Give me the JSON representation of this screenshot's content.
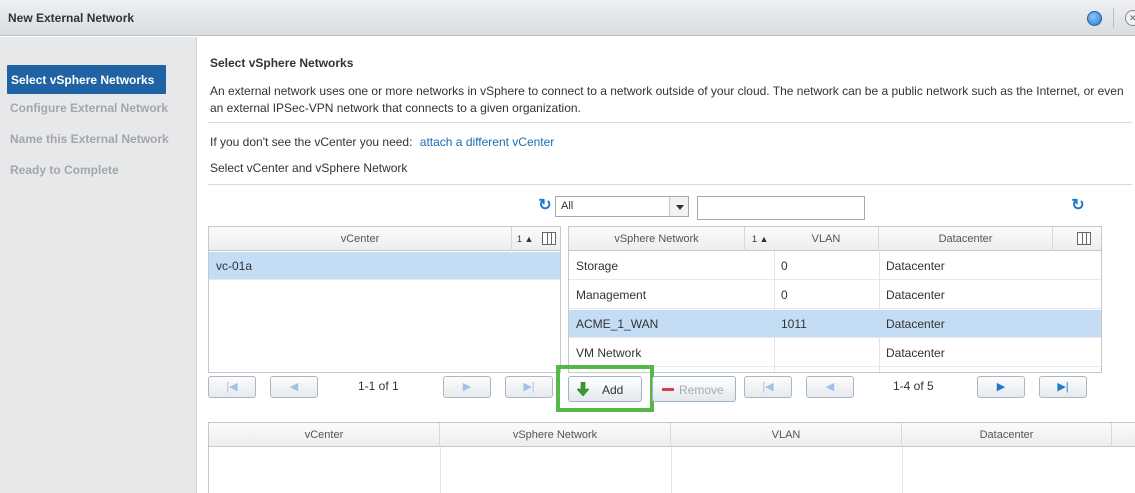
{
  "window": {
    "title": "New External Network"
  },
  "sidebar": {
    "steps": [
      {
        "label": "Select vSphere Networks",
        "active": true
      },
      {
        "label": "Configure External Network",
        "active": false
      },
      {
        "label": "Name this External Network",
        "active": false
      },
      {
        "label": "Ready to Complete",
        "active": false
      }
    ]
  },
  "main": {
    "title": "Select vSphere Networks",
    "description": "An external network uses one or more networks in vSphere to connect to a network outside of your cloud. The network can be a public network such as the Internet, or even an external IPSec-VPN network that connects to a given organization.",
    "vcenter_prompt": "If you don't see the vCenter you need:",
    "vcenter_link": "attach a different vCenter",
    "select_label": "Select vCenter and vSphere Network"
  },
  "vcenter_grid": {
    "columns": [
      "vCenter"
    ],
    "sort_indicator": "1 ▲",
    "rows": [
      {
        "vcenter": "vc-01a",
        "selected": true
      }
    ],
    "pager": {
      "text": "1-1 of 1"
    }
  },
  "network_grid": {
    "filter": {
      "selected": "All",
      "search_value": ""
    },
    "columns": [
      "vSphere Network",
      "VLAN",
      "Datacenter"
    ],
    "sort_indicator": "1 ▲",
    "rows": [
      {
        "network": "Storage",
        "vlan": "0",
        "datacenter": "Datacenter",
        "selected": false
      },
      {
        "network": "Management",
        "vlan": "0",
        "datacenter": "Datacenter",
        "selected": false
      },
      {
        "network": "ACME_1_WAN",
        "vlan": "1011",
        "datacenter": "Datacenter",
        "selected": true
      },
      {
        "network": "VM Network",
        "vlan": "",
        "datacenter": "Datacenter",
        "selected": false
      }
    ],
    "pager": {
      "text": "1-4 of 5"
    }
  },
  "actions": {
    "add_label": "Add",
    "remove_label": "Remove"
  },
  "selected_grid": {
    "columns": [
      "vCenter",
      "vSphere Network",
      "VLAN",
      "Datacenter"
    ]
  },
  "colors": {
    "accent": "#1f63a5",
    "selection": "#c4dcf4",
    "highlight": "#57b84a",
    "link": "#1a6bb5"
  }
}
